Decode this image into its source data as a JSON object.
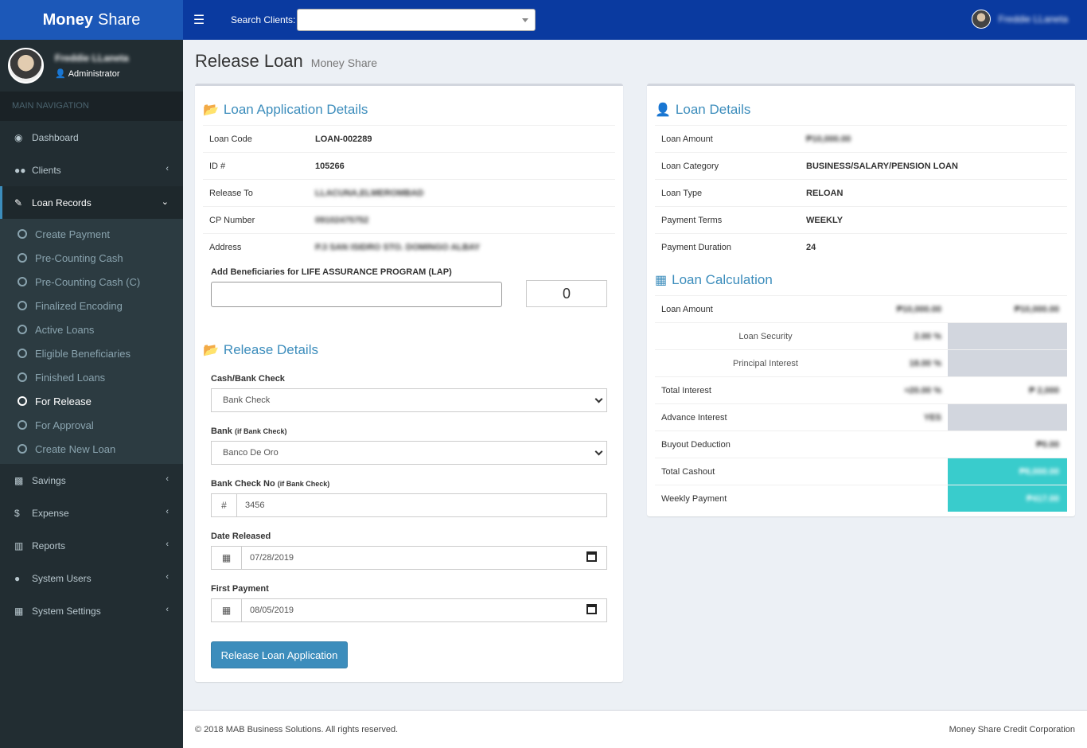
{
  "app": {
    "brand_bold": "Money",
    "brand_rest": "Share"
  },
  "topbar": {
    "search_label": "Search Clients:",
    "search_value": "",
    "user_name": "Freddie LLaneta"
  },
  "sidebar": {
    "user_name": "Freddie LLaneta",
    "user_role": "Administrator",
    "nav_header": "MAIN NAVIGATION",
    "items": {
      "dashboard": "Dashboard",
      "clients": "Clients",
      "loan_records": "Loan Records",
      "savings": "Savings",
      "expense": "Expense",
      "reports": "Reports",
      "system_users": "System Users",
      "system_settings": "System Settings"
    },
    "loan_sub": [
      "Create Payment",
      "Pre-Counting Cash",
      "Pre-Counting Cash (C)",
      "Finalized Encoding",
      "Active Loans",
      "Eligible Beneficiaries",
      "Finished Loans",
      "For Release",
      "For Approval",
      "Create New Loan"
    ]
  },
  "header": {
    "title": "Release Loan",
    "subtitle": "Money Share"
  },
  "application": {
    "title": "Loan Application Details",
    "rows": [
      {
        "label": "Loan Code",
        "value": "LOAN-002289"
      },
      {
        "label": "ID #",
        "value": "105266"
      },
      {
        "label": "Release To",
        "value": "LLACUNA,ELMEROMBAD"
      },
      {
        "label": "CP Number",
        "value": "09102475752"
      },
      {
        "label": "Address",
        "value": "P.3 SAN ISIDRO STO. DOMINGO ALBAY"
      }
    ],
    "beneficiaries_label": "Add Beneficiaries for LIFE ASSURANCE PROGRAM (LAP)",
    "beneficiaries_value": "",
    "beneficiaries_count": "0"
  },
  "release": {
    "title": "Release Details",
    "cash_label": "Cash/Bank Check",
    "cash_value": "Bank Check",
    "bank_label": "Bank",
    "bank_hint": "(if Bank Check)",
    "bank_value": "Banco De Oro",
    "check_label": "Bank Check No",
    "check_hint": "(if Bank Check)",
    "check_prefix": "#",
    "check_value": "3456",
    "date_label": "Date Released",
    "date_value": "07/28/2019",
    "first_label": "First Payment",
    "first_value": "08/05/2019",
    "submit": "Release Loan Application"
  },
  "loan_details": {
    "title": "Loan Details",
    "rows": [
      {
        "label": "Loan Amount",
        "value": "₱10,000.00"
      },
      {
        "label": "Loan Category",
        "value": "BUSINESS/SALARY/PENSION LOAN"
      },
      {
        "label": "Loan Type",
        "value": "RELOAN"
      },
      {
        "label": "Payment Terms",
        "value": "WEEKLY"
      },
      {
        "label": "Payment Duration",
        "value": "24"
      }
    ]
  },
  "calculation": {
    "title": "Loan Calculation",
    "loan_amount": {
      "label": "Loan Amount",
      "v1": "₱10,000.00",
      "v2": "₱10,000.00"
    },
    "loan_security": {
      "label": "Loan Security",
      "v1": "2.00 %"
    },
    "principal_interest": {
      "label": "Principal Interest",
      "v1": "18.00 %"
    },
    "total_interest": {
      "label": "Total Interest",
      "v1": "≈20.00 %",
      "v2": "₱ 2,000"
    },
    "advance_interest": {
      "label": "Advance Interest",
      "v1": "YES"
    },
    "buyout": {
      "label": "Buyout Deduction",
      "v2": "₱0.00"
    },
    "total_cashout": {
      "label": "Total Cashout",
      "v2": "₱8,000.00"
    },
    "weekly_payment": {
      "label": "Weekly Payment",
      "v2": "₱417.00"
    }
  },
  "footer": {
    "left": "© 2018 MAB Business Solutions. All rights reserved.",
    "right": "Money Share Credit Corporation"
  },
  "colors": {
    "brand": "#1c58b8",
    "topbar": "#0a3aa0",
    "sidebar": "#222d32",
    "accent": "#3c8dbc",
    "teal": "#39cccc"
  }
}
